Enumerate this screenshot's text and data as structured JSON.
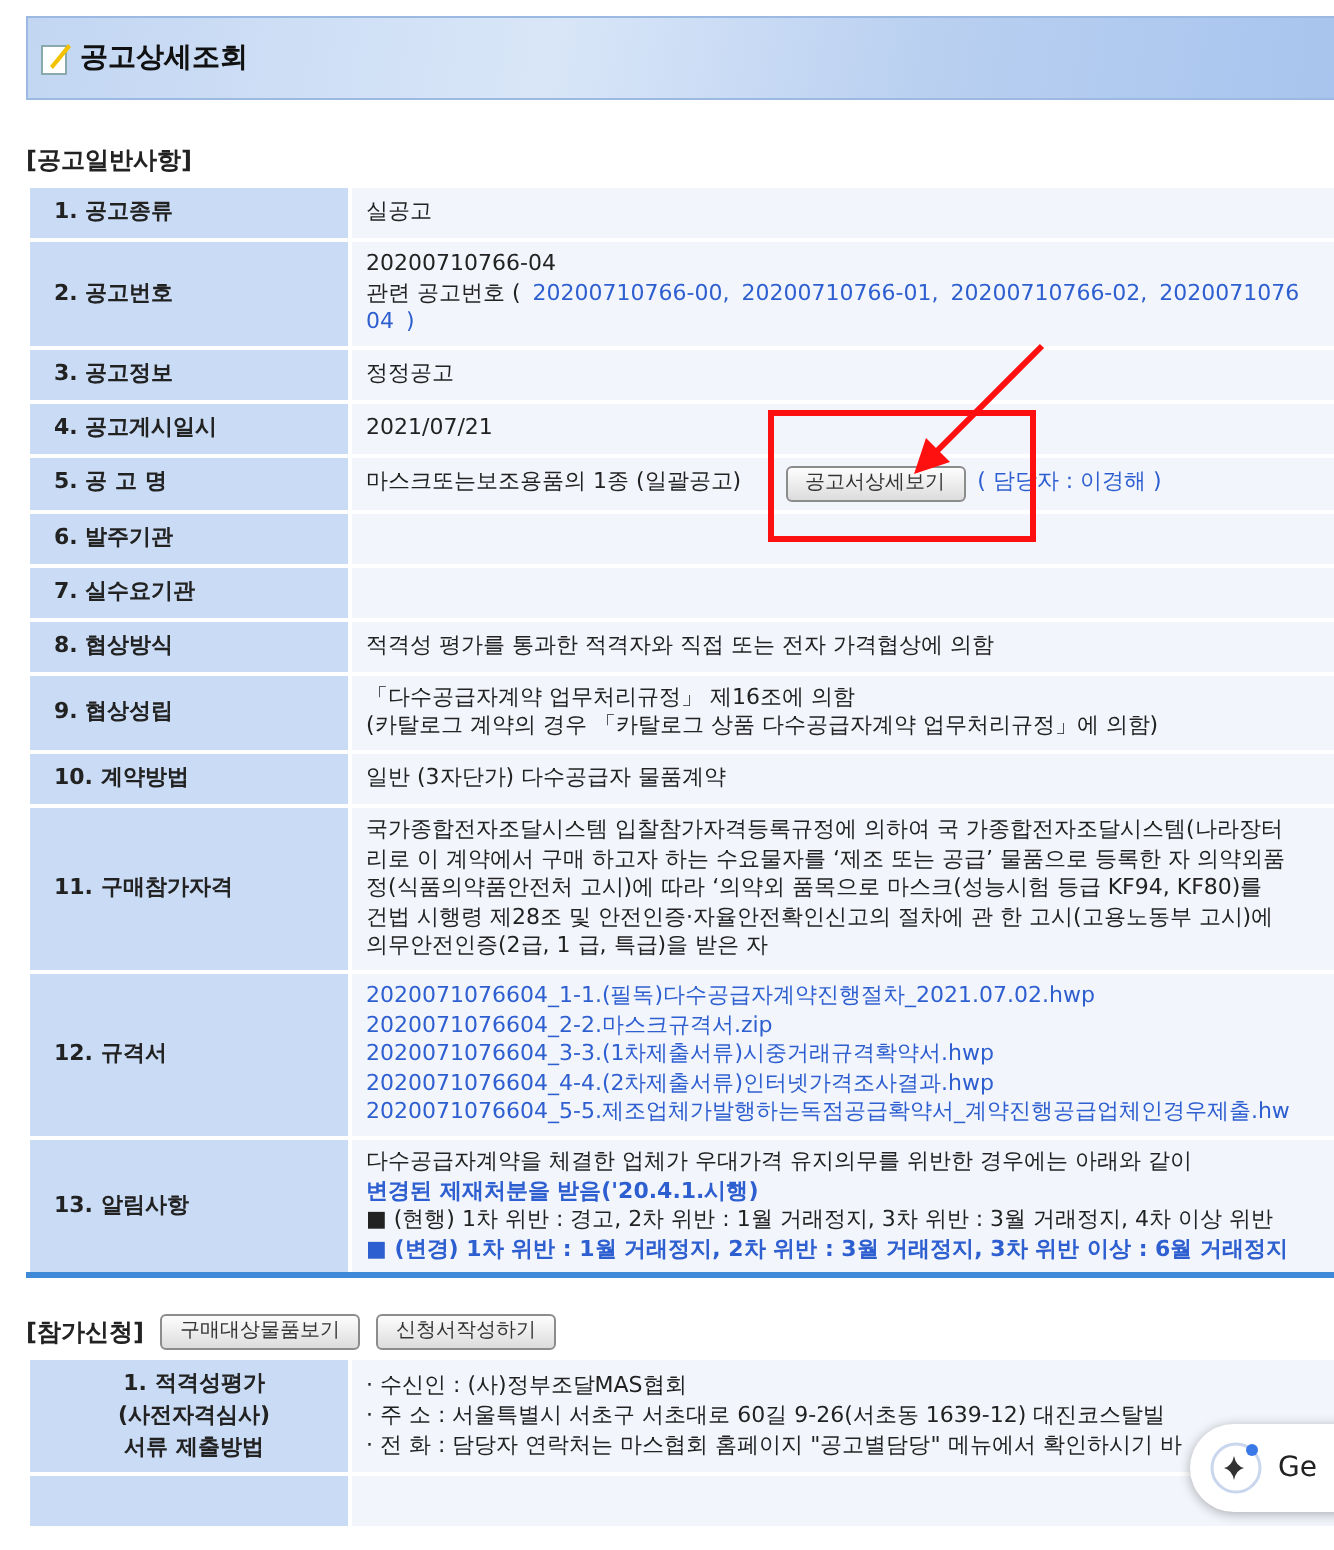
{
  "title": "공고상세조회",
  "general": {
    "heading": "[공고일반사항]",
    "rows": [
      {
        "label": "1. 공고종류",
        "lines": [
          [
            {
              "kind": "text",
              "text": "실공고"
            }
          ]
        ]
      },
      {
        "label": "2. 공고번호",
        "lines": [
          [
            {
              "kind": "text",
              "text": "20200710766-04"
            }
          ],
          [
            {
              "kind": "text",
              "text": "관련 공고번호 ("
            },
            {
              "kind": "link",
              "text": "20200710766-00,"
            },
            {
              "kind": "link",
              "text": "20200710766-01,"
            },
            {
              "kind": "link",
              "text": "20200710766-02,"
            },
            {
              "kind": "link",
              "text": "2020071076"
            }
          ],
          [
            {
              "kind": "link",
              "text": "04"
            },
            {
              "kind": "link",
              "text": ")"
            }
          ]
        ]
      },
      {
        "label": "3. 공고정보",
        "lines": [
          [
            {
              "kind": "text",
              "text": "정정공고"
            }
          ]
        ]
      },
      {
        "label": "4. 공고게시일시",
        "lines": [
          [
            {
              "kind": "text",
              "text": "2021/07/21"
            }
          ]
        ]
      },
      {
        "label": "5. 공 고 명",
        "lines": [
          [
            {
              "kind": "text",
              "text": "마스크또는보조용품의 1종 (일괄공고)"
            },
            {
              "kind": "button",
              "text": "공고서상세보기",
              "highlighted": true
            },
            {
              "kind": "link",
              "text": "( 담당자 : 이경해 )"
            }
          ]
        ]
      },
      {
        "label": "6. 발주기관",
        "lines": []
      },
      {
        "label": "7. 실수요기관",
        "lines": []
      },
      {
        "label": "8. 협상방식",
        "lines": [
          [
            {
              "kind": "text",
              "text": "적격성 평가를 통과한 적격자와 직접 또는 전자 가격협상에 의함"
            }
          ]
        ]
      },
      {
        "label": "9. 협상성립",
        "lines": [
          [
            {
              "kind": "text",
              "text": "「다수공급자계약 업무처리규정」 제16조에 의함"
            }
          ],
          [
            {
              "kind": "text",
              "text": "(카탈로그 계약의 경우 「카탈로그 상품 다수공급자계약 업무처리규정」에 의함)"
            }
          ]
        ]
      },
      {
        "label": "10. 계약방법",
        "lines": [
          [
            {
              "kind": "text",
              "text": "일반 (3자단가) 다수공급자 물품계약"
            }
          ]
        ]
      },
      {
        "label": "11. 구매참가자격",
        "lines": [
          [
            {
              "kind": "text",
              "text": "국가종합전자조달시스템 입찰참가자격등록규정에 의하여 국 가종합전자조달시스템(나라장터"
            }
          ],
          [
            {
              "kind": "text",
              "text": "리로 이 계약에서 구매 하고자 하는 수요물자를 ‘제조 또는 공급’ 물품으로 등록한 자 의약외품"
            }
          ],
          [
            {
              "kind": "text",
              "text": "정(식품의약품안전처 고시)에 따라 ‘의약외 품목으로 마스크(성능시험 등급 KF94, KF80)를"
            }
          ],
          [
            {
              "kind": "text",
              "text": "건법 시행령 제28조 및 안전인증·자율안전확인신고의 절차에 관 한 고시(고용노동부 고시)에"
            }
          ],
          [
            {
              "kind": "text",
              "text": "의무안전인증(2급, 1 급, 특급)을 받은 자"
            }
          ]
        ]
      },
      {
        "label": "12. 규격서",
        "lines": [
          [
            {
              "kind": "link",
              "text": "2020071076604_1-1.(필독)다수공급자계약진행절차_2021.07.02.hwp"
            }
          ],
          [
            {
              "kind": "link",
              "text": "2020071076604_2-2.마스크규격서.zip"
            }
          ],
          [
            {
              "kind": "link",
              "text": "2020071076604_3-3.(1차제출서류)시중거래규격확약서.hwp"
            }
          ],
          [
            {
              "kind": "link",
              "text": "2020071076604_4-4.(2차제출서류)인터넷가격조사결과.hwp"
            }
          ],
          [
            {
              "kind": "link",
              "text": "2020071076604_5-5.제조업체가발행하는독점공급확약서_계약진행공급업체인경우제출.hw"
            }
          ]
        ]
      },
      {
        "label": "13. 알림사항",
        "lines": [
          [
            {
              "kind": "text",
              "text": "다수공급자계약을 체결한 업체가 우대가격 유지의무를 위반한 경우에는 아래와 같이"
            }
          ],
          [
            {
              "kind": "strong",
              "text": "변경된 제재처분을 받음('20.4.1.시행)"
            }
          ],
          [
            {
              "kind": "text",
              "text": "■ (현행) 1차 위반 : 경고, 2차 위반 : 1월 거래정지, 3차 위반 : 3월 거래정지, 4차 이상 위반"
            }
          ],
          [
            {
              "kind": "strong",
              "text": "■ (변경) 1차 위반 : 1월 거래정지, 2차 위반 : 3월 거래정지, 3차 위반 이상 : 6월 거래정지"
            }
          ]
        ]
      }
    ]
  },
  "participation": {
    "heading": "[참가신청]",
    "buttons": [
      "구매대상물품보기",
      "신청서작성하기"
    ],
    "rows": [
      {
        "label": "1. 적격성평가\n(사전자격심사)\n서류 제출방법",
        "lines": [
          [
            {
              "kind": "text",
              "text": "· 수신인 : (사)정부조달MAS협회"
            }
          ],
          [
            {
              "kind": "text",
              "text": "· 주 소 : 서울특별시 서초구 서초대로 60길 9-26(서초동 1639-12) 대진코스탈빌"
            }
          ],
          [
            {
              "kind": "text",
              "text": "· 전 화 : 담당자 연락처는 마스협회 홈페이지 \"공고별담당\" 메뉴에서 확인하시기 바"
            }
          ]
        ]
      },
      {
        "label": "",
        "lines": []
      }
    ]
  },
  "assistant_chip": {
    "label": "Ge"
  }
}
